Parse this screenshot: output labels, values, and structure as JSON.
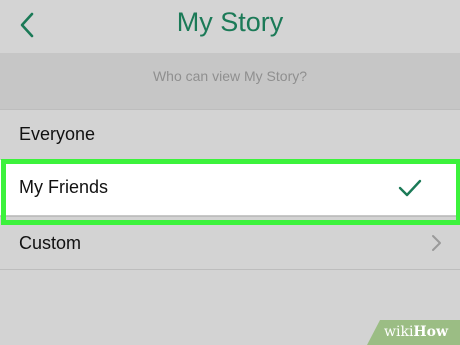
{
  "header": {
    "title": "My Story",
    "back_icon": "chevron-left-icon"
  },
  "section": {
    "label": "Who can view My Story?"
  },
  "options": [
    {
      "label": "Everyone",
      "selected": false
    },
    {
      "label": "My Friends",
      "selected": true,
      "indicator_icon": "check-icon"
    },
    {
      "label": "Custom",
      "selected": false,
      "indicator_icon": "chevron-right-icon"
    }
  ],
  "watermark": {
    "text_light": "wiki",
    "text_bold": "How"
  },
  "colors": {
    "accent": "#1b7a57",
    "highlight": "#3cf23c",
    "background": "#d3d3d3",
    "section_background": "#c6c6c6"
  }
}
